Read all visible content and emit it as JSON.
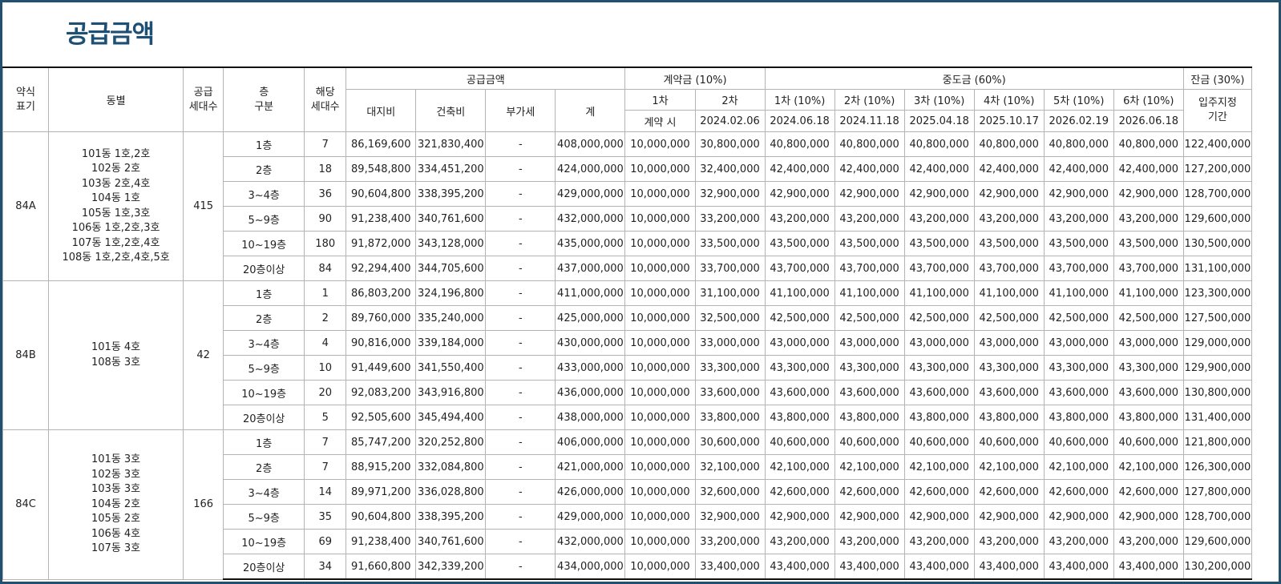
{
  "title": "공급금액",
  "headers": {
    "type": [
      "약식",
      "표기"
    ],
    "dong": "동별",
    "supply_units": [
      "공급",
      "세대수"
    ],
    "floor": [
      "층",
      "구분"
    ],
    "units": [
      "해당",
      "세대수"
    ],
    "supply_amount": "공급금액",
    "land": "대지비",
    "building": "건축비",
    "vat": "부가세",
    "total": "계",
    "contract": "계약금 (10%)",
    "contract_1": "1차",
    "contract_1_when": "계약 시",
    "contract_2": "2차",
    "contract_2_date": "2024.02.06",
    "middle": "중도금 (60%)",
    "mid_labels": [
      "1차 (10%)",
      "2차 (10%)",
      "3차 (10%)",
      "4차 (10%)",
      "5차 (10%)",
      "6차 (10%)"
    ],
    "mid_dates": [
      "2024.06.18",
      "2024.11.18",
      "2025.04.18",
      "2025.10.17",
      "2026.02.19",
      "2026.06.18"
    ],
    "balance": "잔금 (30%)",
    "balance_when": [
      "입주지정",
      "기간"
    ]
  },
  "groups": [
    {
      "type": "84A",
      "dongs": [
        "101동 1호,2호",
        "102동 2호",
        "103동 2호,4호",
        "104동 1호",
        "105동 1호,3호",
        "106동 1호,2호,3호",
        "107동 1호,2호,4호",
        "108동 1호,2호,4호,5호"
      ],
      "supply_units": "415",
      "rows": [
        {
          "floor": "1층",
          "units": "7",
          "land": "86,169,600",
          "building": "321,830,400",
          "vat": "-",
          "total": "408,000,000",
          "c1": "10,000,000",
          "c2": "30,800,000",
          "mid": "40,800,000",
          "bal": "122,400,000"
        },
        {
          "floor": "2층",
          "units": "18",
          "land": "89,548,800",
          "building": "334,451,200",
          "vat": "-",
          "total": "424,000,000",
          "c1": "10,000,000",
          "c2": "32,400,000",
          "mid": "42,400,000",
          "bal": "127,200,000"
        },
        {
          "floor": "3~4층",
          "units": "36",
          "land": "90,604,800",
          "building": "338,395,200",
          "vat": "-",
          "total": "429,000,000",
          "c1": "10,000,000",
          "c2": "32,900,000",
          "mid": "42,900,000",
          "bal": "128,700,000"
        },
        {
          "floor": "5~9층",
          "units": "90",
          "land": "91,238,400",
          "building": "340,761,600",
          "vat": "-",
          "total": "432,000,000",
          "c1": "10,000,000",
          "c2": "33,200,000",
          "mid": "43,200,000",
          "bal": "129,600,000"
        },
        {
          "floor": "10~19층",
          "units": "180",
          "land": "91,872,000",
          "building": "343,128,000",
          "vat": "-",
          "total": "435,000,000",
          "c1": "10,000,000",
          "c2": "33,500,000",
          "mid": "43,500,000",
          "bal": "130,500,000"
        },
        {
          "floor": "20층이상",
          "units": "84",
          "land": "92,294,400",
          "building": "344,705,600",
          "vat": "-",
          "total": "437,000,000",
          "c1": "10,000,000",
          "c2": "33,700,000",
          "mid": "43,700,000",
          "bal": "131,100,000"
        }
      ]
    },
    {
      "type": "84B",
      "dongs": [
        "101동 4호",
        "108동 3호"
      ],
      "supply_units": "42",
      "rows": [
        {
          "floor": "1층",
          "units": "1",
          "land": "86,803,200",
          "building": "324,196,800",
          "vat": "-",
          "total": "411,000,000",
          "c1": "10,000,000",
          "c2": "31,100,000",
          "mid": "41,100,000",
          "bal": "123,300,000"
        },
        {
          "floor": "2층",
          "units": "2",
          "land": "89,760,000",
          "building": "335,240,000",
          "vat": "-",
          "total": "425,000,000",
          "c1": "10,000,000",
          "c2": "32,500,000",
          "mid": "42,500,000",
          "bal": "127,500,000"
        },
        {
          "floor": "3~4층",
          "units": "4",
          "land": "90,816,000",
          "building": "339,184,000",
          "vat": "-",
          "total": "430,000,000",
          "c1": "10,000,000",
          "c2": "33,000,000",
          "mid": "43,000,000",
          "bal": "129,000,000"
        },
        {
          "floor": "5~9층",
          "units": "10",
          "land": "91,449,600",
          "building": "341,550,400",
          "vat": "-",
          "total": "433,000,000",
          "c1": "10,000,000",
          "c2": "33,300,000",
          "mid": "43,300,000",
          "bal": "129,900,000"
        },
        {
          "floor": "10~19층",
          "units": "20",
          "land": "92,083,200",
          "building": "343,916,800",
          "vat": "-",
          "total": "436,000,000",
          "c1": "10,000,000",
          "c2": "33,600,000",
          "mid": "43,600,000",
          "bal": "130,800,000"
        },
        {
          "floor": "20층이상",
          "units": "5",
          "land": "92,505,600",
          "building": "345,494,400",
          "vat": "-",
          "total": "438,000,000",
          "c1": "10,000,000",
          "c2": "33,800,000",
          "mid": "43,800,000",
          "bal": "131,400,000"
        }
      ]
    },
    {
      "type": "84C",
      "dongs": [
        "101동 3호",
        "102동 3호",
        "103동 3호",
        "104동 2호",
        "105동 2호",
        "106동 4호",
        "107동 3호"
      ],
      "supply_units": "166",
      "rows": [
        {
          "floor": "1층",
          "units": "7",
          "land": "85,747,200",
          "building": "320,252,800",
          "vat": "-",
          "total": "406,000,000",
          "c1": "10,000,000",
          "c2": "30,600,000",
          "mid": "40,600,000",
          "bal": "121,800,000"
        },
        {
          "floor": "2층",
          "units": "7",
          "land": "88,915,200",
          "building": "332,084,800",
          "vat": "-",
          "total": "421,000,000",
          "c1": "10,000,000",
          "c2": "32,100,000",
          "mid": "42,100,000",
          "bal": "126,300,000"
        },
        {
          "floor": "3~4층",
          "units": "14",
          "land": "89,971,200",
          "building": "336,028,800",
          "vat": "-",
          "total": "426,000,000",
          "c1": "10,000,000",
          "c2": "32,600,000",
          "mid": "42,600,000",
          "bal": "127,800,000"
        },
        {
          "floor": "5~9층",
          "units": "35",
          "land": "90,604,800",
          "building": "338,395,200",
          "vat": "-",
          "total": "429,000,000",
          "c1": "10,000,000",
          "c2": "32,900,000",
          "mid": "42,900,000",
          "bal": "128,700,000"
        },
        {
          "floor": "10~19층",
          "units": "69",
          "land": "91,238,400",
          "building": "340,761,600",
          "vat": "-",
          "total": "432,000,000",
          "c1": "10,000,000",
          "c2": "33,200,000",
          "mid": "43,200,000",
          "bal": "129,600,000"
        },
        {
          "floor": "20층이상",
          "units": "34",
          "land": "91,660,800",
          "building": "342,339,200",
          "vat": "-",
          "total": "434,000,000",
          "c1": "10,000,000",
          "c2": "33,400,000",
          "mid": "43,400,000",
          "bal": "130,200,000"
        }
      ]
    }
  ]
}
